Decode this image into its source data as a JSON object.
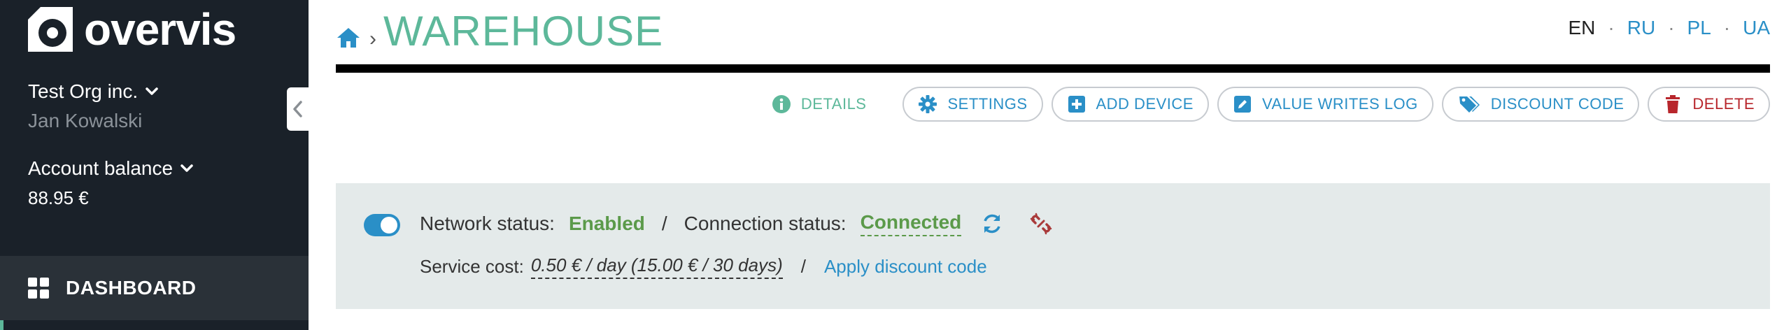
{
  "brand": {
    "name": "overvis"
  },
  "account": {
    "org": "Test Org inc.",
    "user": "Jan Kowalski",
    "balance_label": "Account balance",
    "balance_value": "88.95 €"
  },
  "nav": {
    "dashboard": "DASHBOARD"
  },
  "header": {
    "title": "WAREHOUSE",
    "separator": "›",
    "languages": [
      "EN",
      "RU",
      "PL",
      "UA"
    ],
    "active_language": "EN"
  },
  "toolbar": {
    "details": "DETAILS",
    "settings": "SETTINGS",
    "add_device": "ADD DEVICE",
    "value_writes_log": "VALUE WRITES LOG",
    "discount_code": "DISCOUNT CODE",
    "delete": "DELETE"
  },
  "status": {
    "network_label": "Network status:",
    "network_value": "Enabled",
    "slash": "/",
    "connection_label": "Connection status:",
    "connection_value": "Connected",
    "service_cost_label": "Service cost:",
    "service_cost_value": "0.50 € / day (15.00 € / 30 days)",
    "apply_discount": "Apply discount code",
    "network_enabled": true
  },
  "colors": {
    "accent_green": "#5db89a",
    "link_blue": "#2a8fc7",
    "danger_red": "#b8262c",
    "sidebar_bg": "#1a2129",
    "panel_bg": "#e4eaea"
  }
}
